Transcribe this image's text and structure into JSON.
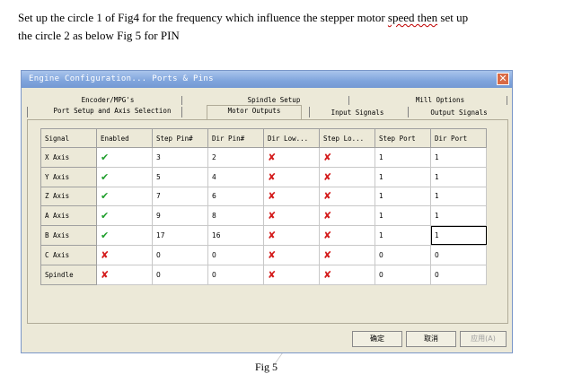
{
  "document": {
    "line1_before": "Set up the circle 1 of Fig4 for the frequency which influence the stepper motor ",
    "line1_squiggle": "speed then",
    "line1_after": " set up",
    "line2": "the circle 2 as below Fig 5 for PIN",
    "caption": "Fig 5"
  },
  "dialog": {
    "title": "Engine Configuration... Ports & Pins",
    "close_symbol": "✕",
    "tabs_top": [
      "Encoder/MPG's",
      "Spindle Setup",
      "Mill Options"
    ],
    "tabs_bottom": [
      "Port Setup and Axis Selection",
      "Motor Outputs",
      "Input Signals",
      "Output Signals"
    ],
    "active_tab": "Motor Outputs",
    "columns": [
      "Signal",
      "Enabled",
      "Step Pin#",
      "Dir Pin#",
      "Dir Low...",
      "Step Lo...",
      "Step Port",
      "Dir Port"
    ],
    "rows": [
      {
        "signal": "X Axis",
        "enabled": "✔",
        "step_pin": "3",
        "dir_pin": "2",
        "dir_low": "✘",
        "step_low": "✘",
        "step_port": "1",
        "dir_port": "1"
      },
      {
        "signal": "Y Axis",
        "enabled": "✔",
        "step_pin": "5",
        "dir_pin": "4",
        "dir_low": "✘",
        "step_low": "✘",
        "step_port": "1",
        "dir_port": "1"
      },
      {
        "signal": "Z Axis",
        "enabled": "✔",
        "step_pin": "7",
        "dir_pin": "6",
        "dir_low": "✘",
        "step_low": "✘",
        "step_port": "1",
        "dir_port": "1"
      },
      {
        "signal": "A Axis",
        "enabled": "✔",
        "step_pin": "9",
        "dir_pin": "8",
        "dir_low": "✘",
        "step_low": "✘",
        "step_port": "1",
        "dir_port": "1"
      },
      {
        "signal": "B Axis",
        "enabled": "✔",
        "step_pin": "17",
        "dir_pin": "16",
        "dir_low": "✘",
        "step_low": "✘",
        "step_port": "1",
        "dir_port": "1"
      },
      {
        "signal": "C Axis",
        "enabled": "✘",
        "step_pin": "0",
        "dir_pin": "0",
        "dir_low": "✘",
        "step_low": "✘",
        "step_port": "0",
        "dir_port": "0"
      },
      {
        "signal": "Spindle",
        "enabled": "✘",
        "step_pin": "0",
        "dir_pin": "0",
        "dir_low": "✘",
        "step_low": "✘",
        "step_port": "0",
        "dir_port": "0"
      }
    ],
    "buttons": {
      "ok": "确定",
      "cancel": "取消",
      "apply": "应用(A)"
    },
    "colors": {
      "check_green": "#1f9e2c",
      "cross_red": "#d41c1c",
      "title_blue": "#7fa4dc"
    }
  }
}
